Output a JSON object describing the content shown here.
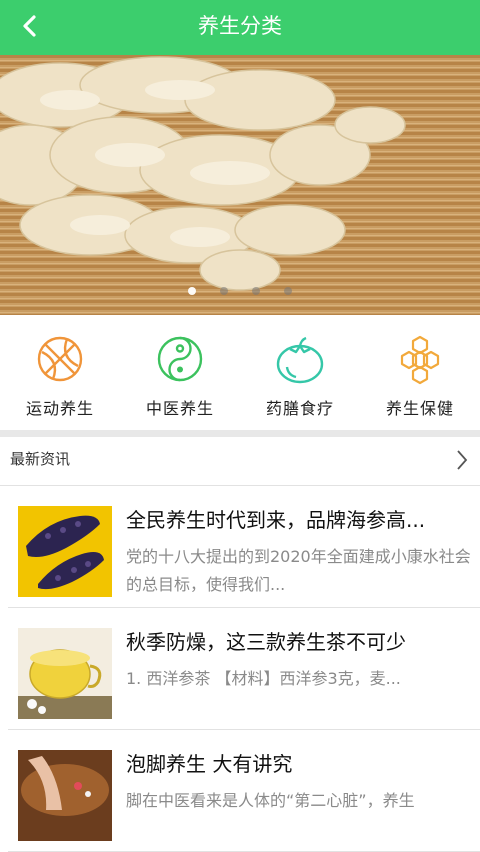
{
  "header": {
    "title": "养生分类",
    "back_icon": "chevron-left-icon"
  },
  "banner": {
    "slide_count": 4,
    "active_index": 0
  },
  "categories": [
    {
      "label": "运动养生",
      "icon": "basketball-icon",
      "color": "#f0953a"
    },
    {
      "label": "中医养生",
      "icon": "yin-yang-icon",
      "color": "#3cc25e"
    },
    {
      "label": "药膳食疗",
      "icon": "tomato-icon",
      "color": "#35c7a8"
    },
    {
      "label": "养生保健",
      "icon": "honeycomb-icon",
      "color": "#f2a93b"
    }
  ],
  "news": {
    "section_label": "最新资讯",
    "items": [
      {
        "title": "全民养生时代到来，品牌海参高...",
        "desc": "党的十八大提出的到2020年全面建成小康水社会的总目标，使得我们..."
      },
      {
        "title": "秋季防燥，这三款养生茶不可少",
        "desc": "1. 西洋参茶 【材料】西洋参3克，麦..."
      },
      {
        "title": "泡脚养生 大有讲究",
        "desc": "脚在中医看来是人体的“第二心脏”，养生"
      }
    ]
  },
  "colors": {
    "brand": "#3cce6d"
  }
}
